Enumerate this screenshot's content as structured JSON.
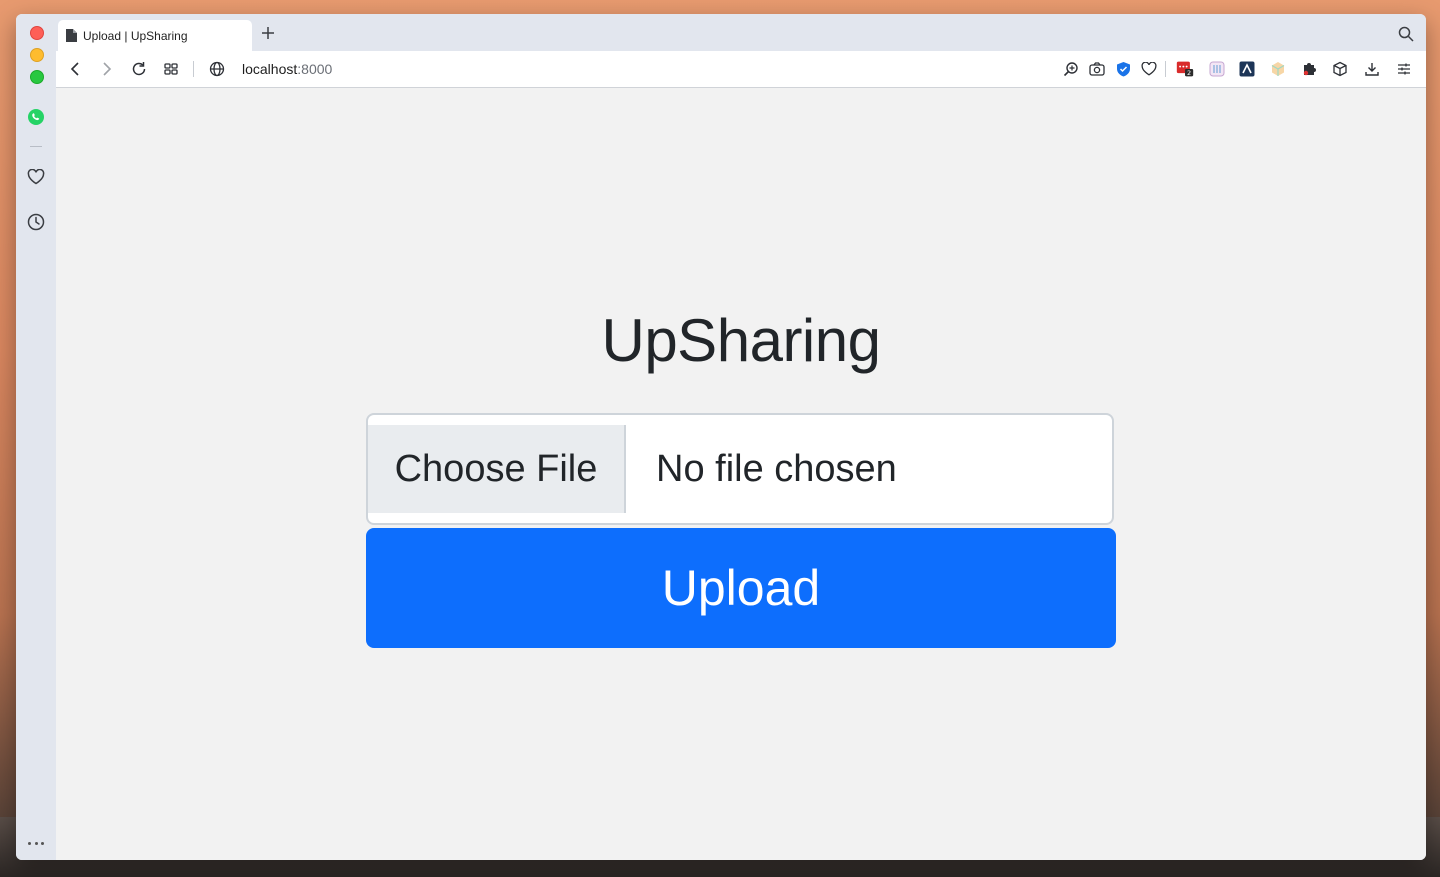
{
  "browser": {
    "tab": {
      "title": "Upload | UpSharing"
    },
    "address": {
      "host": "localhost",
      "port": ":8000"
    },
    "extension_badge": "2"
  },
  "page": {
    "brand": "UpSharing",
    "file_input": {
      "button_label": "Choose File",
      "status": "No file chosen"
    },
    "upload_button": "Upload"
  },
  "colors": {
    "primary": "#0d6efd",
    "text": "#212529",
    "page_bg": "#f2f2f2"
  }
}
